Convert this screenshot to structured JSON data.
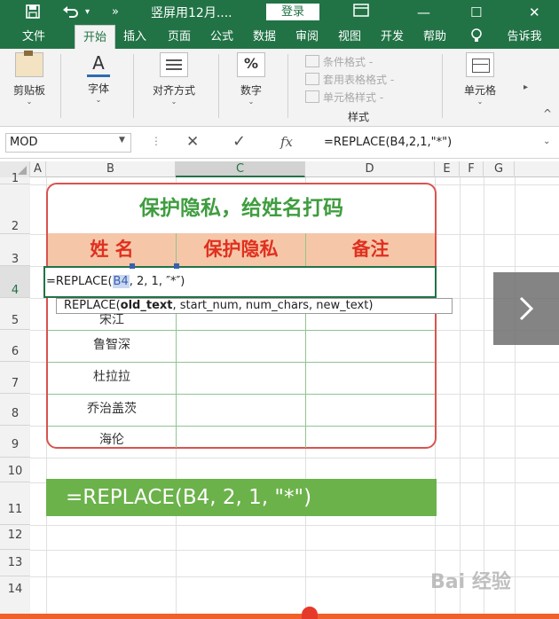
{
  "titlebar": {
    "save_icon": "save-icon",
    "undo_icon": "undo-icon",
    "more": "»",
    "title": "竖屏用12月....",
    "login": "登录",
    "minimize": "—",
    "maximize": "☐",
    "close": "✕",
    "restore_icon": "ribbon-display-icon"
  },
  "tabs": [
    "文件",
    "开始",
    "插入",
    "页面",
    "公式",
    "数据",
    "审阅",
    "视图",
    "开发",
    "帮助",
    "告诉我"
  ],
  "ribbon": {
    "clipboard": "剪贴板",
    "font": "字体",
    "align": "对齐方式",
    "number": "数字",
    "number_symbol": "%",
    "cond_format": "条件格式 -",
    "table_format": "套用表格格式 -",
    "cell_style": "单元格样式 -",
    "styles_group": "样式",
    "cells": "单元格",
    "dropdown_arrow": "⌄",
    "collapse": "^"
  },
  "formula_bar": {
    "name_box": "MOD",
    "cancel": "✕",
    "enter": "✓",
    "fx": "fx",
    "formula": "=REPLACE(B4,2,1,\"*\")"
  },
  "columns": [
    "A",
    "B",
    "C",
    "D",
    "E",
    "F",
    "G"
  ],
  "rows": [
    "1",
    "2",
    "3",
    "4",
    "5",
    "6",
    "7",
    "8",
    "9",
    "10",
    "11",
    "12",
    "13",
    "14"
  ],
  "sheet": {
    "card_title": "保护隐私，给姓名打码",
    "headers": [
      "姓   名",
      "保护隐私",
      "备注"
    ],
    "names": [
      "",
      "鲁智深",
      "杜拉拉",
      "乔治盖茨",
      "海伦"
    ],
    "partial_name": "宋江",
    "edit_text_prefix": "=REPLACE(",
    "edit_text_ref": "B4",
    "edit_text_suffix": ", 2, 1, ″*″)",
    "tooltip_prefix": "REPLACE(",
    "tooltip_bold": "old_text",
    "tooltip_suffix": ", start_num, num_chars, new_text)",
    "banner": "=REPLACE(B4, 2, 1, \"*\")"
  },
  "watermark": "Bai 经验",
  "colors": {
    "excel_green": "#217346",
    "card_border": "#d9534f",
    "title_green": "#3f9d3f",
    "header_fill": "#f5c7a8",
    "header_text": "#e03020",
    "banner_green": "#6bb24a"
  }
}
